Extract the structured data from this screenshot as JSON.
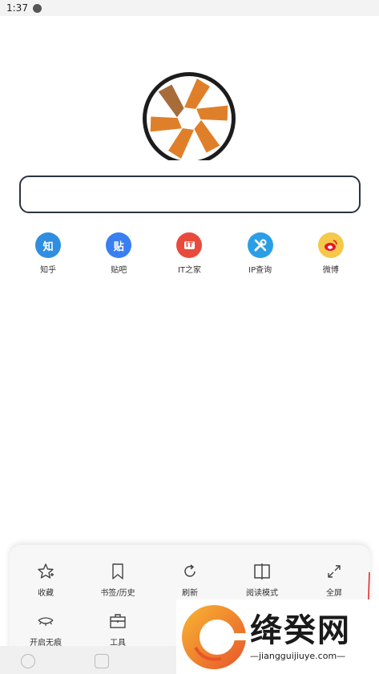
{
  "status_bar": {
    "time": "1:37"
  },
  "search": {
    "placeholder": ""
  },
  "shortcuts": [
    {
      "label": "知乎",
      "icon_text": "知",
      "color": "#2f8ee0"
    },
    {
      "label": "贴吧",
      "icon_text": "贴",
      "color": "#3a7ff0"
    },
    {
      "label": "IT之家",
      "icon_text": "IT",
      "color": "#e84b3c"
    },
    {
      "label": "IP查询",
      "icon_text": "",
      "color": "#2a9fe6"
    },
    {
      "label": "微博",
      "icon_text": "",
      "color": "#f5c84a"
    }
  ],
  "menu": {
    "row1": [
      {
        "label": "收藏",
        "icon": "star-plus-icon"
      },
      {
        "label": "书签/历史",
        "icon": "bookmark-icon"
      },
      {
        "label": "刷新",
        "icon": "refresh-icon"
      },
      {
        "label": "阅读模式",
        "icon": "reading-mode-icon"
      },
      {
        "label": "全屏",
        "icon": "fullscreen-icon"
      }
    ],
    "row2": [
      {
        "label": "开启无痕",
        "icon": "incognito-eye-icon"
      },
      {
        "label": "工具",
        "icon": "toolbox-icon"
      }
    ]
  },
  "watermark": {
    "brand": "绛癸网",
    "domain": "—jiangguijiuye.com—"
  }
}
